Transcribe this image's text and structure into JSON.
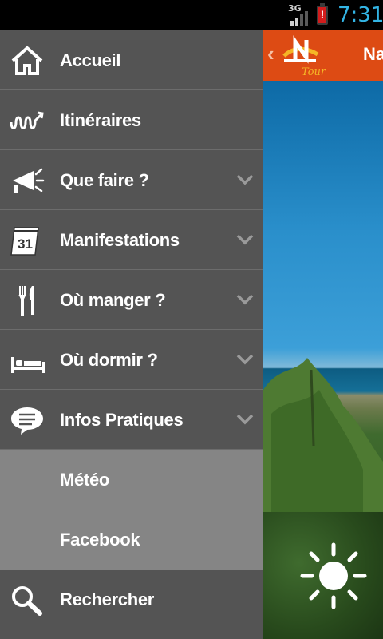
{
  "status_bar": {
    "network": "3G",
    "time": "7:31",
    "battery_alert": "!",
    "colors": {
      "time": "#33b5e5",
      "battery": "#d21c1c"
    }
  },
  "drawer": {
    "items": [
      {
        "label": "Accueil",
        "icon": "home-icon",
        "expandable": false
      },
      {
        "label": "Itinéraires",
        "icon": "route-icon",
        "expandable": false
      },
      {
        "label": "Que faire ?",
        "icon": "megaphone-icon",
        "expandable": true
      },
      {
        "label": "Manifestations",
        "icon": "calendar-icon",
        "expandable": true,
        "icon_text": "31"
      },
      {
        "label": "Où manger ?",
        "icon": "cutlery-icon",
        "expandable": true
      },
      {
        "label": "Où dormir ?",
        "icon": "bed-icon",
        "expandable": true
      },
      {
        "label": "Infos Pratiques",
        "icon": "speech-bubble-icon",
        "expandable": true,
        "expanded": true
      },
      {
        "label": "Rechercher",
        "icon": "search-icon",
        "expandable": false
      }
    ],
    "sub_items": [
      {
        "label": "Météo"
      },
      {
        "label": "Facebook"
      }
    ],
    "colors": {
      "background": "#545454",
      "sub_background": "#858585",
      "divider": "#6c6c6c"
    }
  },
  "main": {
    "appbar": {
      "back": "‹",
      "logo_text": "Tour",
      "title": "Na",
      "color": "#dd4b14"
    },
    "weather_icon": "sun-icon"
  }
}
